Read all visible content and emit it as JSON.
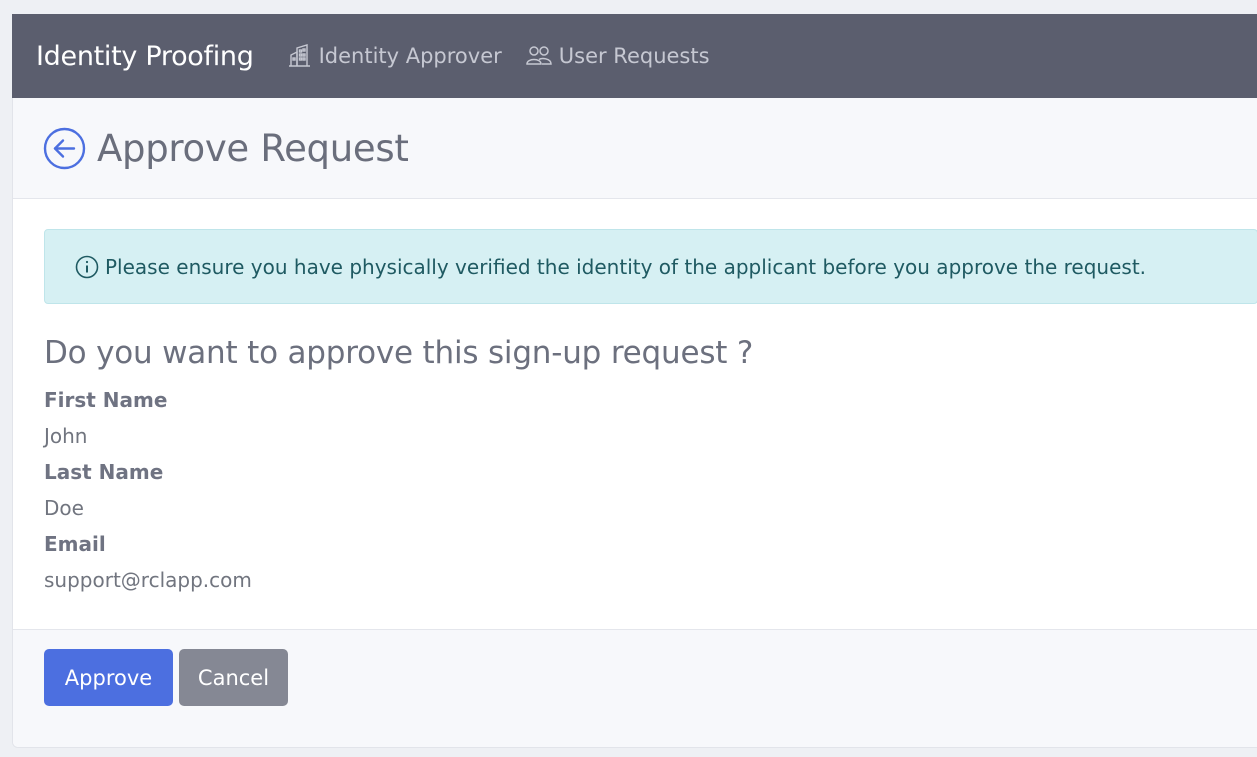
{
  "navbar": {
    "brand": "Identity Proofing",
    "links": [
      {
        "label": "Identity Approver",
        "icon": "building-icon"
      },
      {
        "label": "User Requests",
        "icon": "people-icon"
      }
    ]
  },
  "header": {
    "title": "Approve Request",
    "back_icon": "arrow-left-circle-icon"
  },
  "alert": {
    "icon": "info-circle-icon",
    "text": "Please ensure you have physically verified the identity of the applicant before you approve the request."
  },
  "question": "Do you want to approve this sign-up request ?",
  "fields": [
    {
      "label": "First Name",
      "value": "John"
    },
    {
      "label": "Last Name",
      "value": "Doe"
    },
    {
      "label": "Email",
      "value": "support@rclapp.com"
    }
  ],
  "actions": {
    "approve_label": "Approve",
    "cancel_label": "Cancel"
  },
  "colors": {
    "navbar": "#5b5e6e",
    "primary": "#4c6fe0",
    "secondary": "#858894",
    "alert_bg": "#d6f0f3"
  }
}
